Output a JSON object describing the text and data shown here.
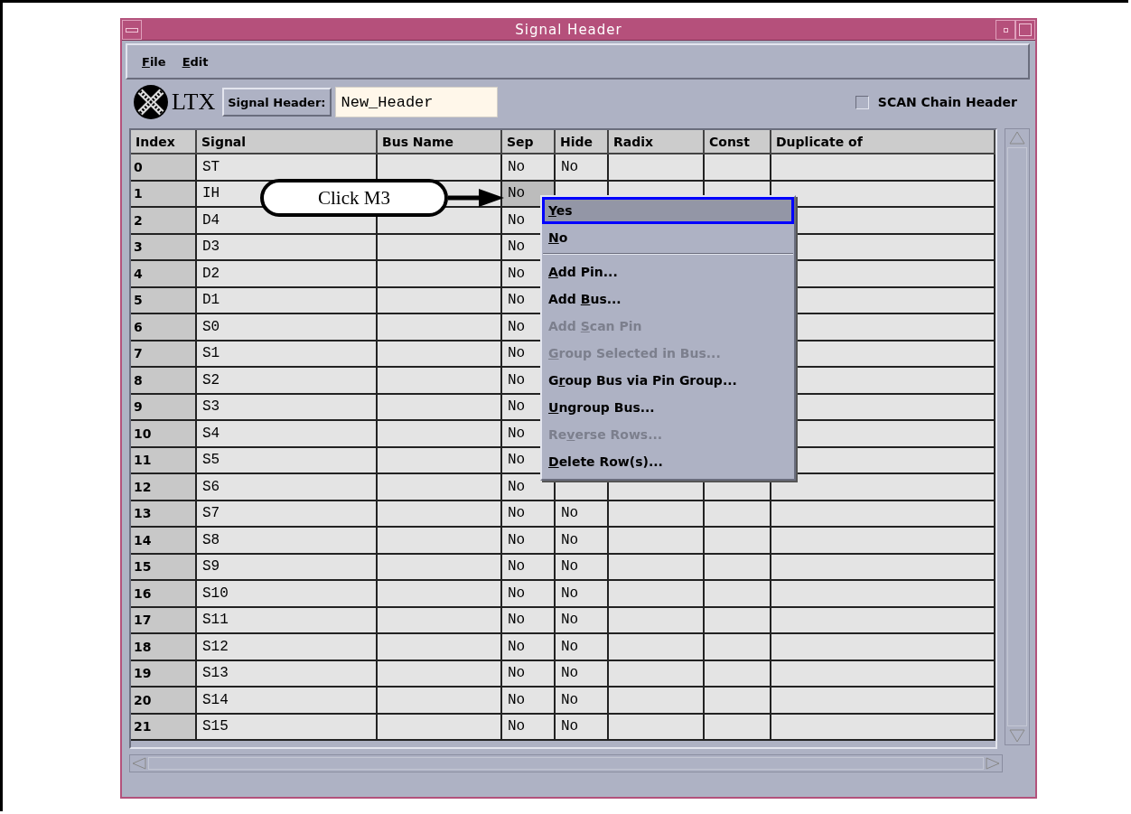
{
  "window": {
    "title": "Signal Header"
  },
  "menu_bar": [
    {
      "key": "F",
      "post": "ile"
    },
    {
      "key": "E",
      "post": "dit"
    }
  ],
  "toolbar": {
    "logo_text": "LTX",
    "header_button": "Signal Header:",
    "header_field": {
      "value": "New_Header"
    },
    "scan_chain": {
      "label": "SCAN Chain Header",
      "checked": false
    }
  },
  "table": {
    "columns": [
      "Index",
      "Signal",
      "Bus Name",
      "Sep",
      "Hide",
      "Radix",
      "Const",
      "Duplicate of"
    ],
    "rows": [
      {
        "index": "0",
        "signal": "ST",
        "sep": "No",
        "hide": "No",
        "selected": false
      },
      {
        "index": "1",
        "signal": "IH",
        "sep": "No",
        "selected": true
      },
      {
        "index": "2",
        "signal": "D4",
        "sep": "No",
        "selected": false
      },
      {
        "index": "3",
        "signal": "D3",
        "sep": "No",
        "selected": false
      },
      {
        "index": "4",
        "signal": "D2",
        "sep": "No",
        "selected": false
      },
      {
        "index": "5",
        "signal": "D1",
        "sep": "No",
        "selected": false
      },
      {
        "index": "6",
        "signal": "S0",
        "sep": "No",
        "selected": false
      },
      {
        "index": "7",
        "signal": "S1",
        "sep": "No",
        "selected": false
      },
      {
        "index": "8",
        "signal": "S2",
        "sep": "No",
        "selected": false
      },
      {
        "index": "9",
        "signal": "S3",
        "sep": "No",
        "selected": false
      },
      {
        "index": "10",
        "signal": "S4",
        "sep": "No",
        "selected": false
      },
      {
        "index": "11",
        "signal": "S5",
        "sep": "No",
        "selected": false
      },
      {
        "index": "12",
        "signal": "S6",
        "sep": "No",
        "selected": false
      },
      {
        "index": "13",
        "signal": "S7",
        "sep": "No",
        "hide": "No",
        "selected": false
      },
      {
        "index": "14",
        "signal": "S8",
        "sep": "No",
        "hide": "No",
        "selected": false
      },
      {
        "index": "15",
        "signal": "S9",
        "sep": "No",
        "hide": "No",
        "selected": false
      },
      {
        "index": "16",
        "signal": "S10",
        "sep": "No",
        "hide": "No",
        "selected": false
      },
      {
        "index": "17",
        "signal": "S11",
        "sep": "No",
        "hide": "No",
        "selected": false
      },
      {
        "index": "18",
        "signal": "S12",
        "sep": "No",
        "hide": "No",
        "selected": false
      },
      {
        "index": "19",
        "signal": "S13",
        "sep": "No",
        "hide": "No",
        "selected": false
      },
      {
        "index": "20",
        "signal": "S14",
        "sep": "No",
        "hide": "No",
        "selected": false
      },
      {
        "index": "21",
        "signal": "S15",
        "sep": "No",
        "hide": "No",
        "selected": false
      }
    ]
  },
  "context_menu": [
    {
      "kind": "item",
      "key": "Y",
      "post": "es",
      "selected": true,
      "disabled": false
    },
    {
      "kind": "item",
      "key": "N",
      "post": "o",
      "selected": false,
      "disabled": false
    },
    {
      "kind": "separator"
    },
    {
      "kind": "item",
      "key": "A",
      "post": "dd Pin...",
      "selected": false,
      "disabled": false
    },
    {
      "kind": "item",
      "pre": "Add ",
      "key": "B",
      "post": "us...",
      "selected": false,
      "disabled": false
    },
    {
      "kind": "item",
      "pre": "Add ",
      "key": "S",
      "post": "can Pin",
      "selected": false,
      "disabled": true
    },
    {
      "kind": "item",
      "key": "G",
      "post": "roup Selected in Bus...",
      "selected": false,
      "disabled": true
    },
    {
      "kind": "item",
      "pre": "G",
      "key": "r",
      "post": "oup Bus via Pin Group...",
      "selected": false,
      "disabled": false
    },
    {
      "kind": "item",
      "key": "U",
      "post": "ngroup Bus...",
      "selected": false,
      "disabled": false
    },
    {
      "kind": "item",
      "pre": "Re",
      "key": "v",
      "post": "erse Rows...",
      "selected": false,
      "disabled": true
    },
    {
      "kind": "item",
      "key": "D",
      "post": "elete Row(s)...",
      "selected": false,
      "disabled": false
    }
  ],
  "callout": {
    "text": "Click M3"
  }
}
